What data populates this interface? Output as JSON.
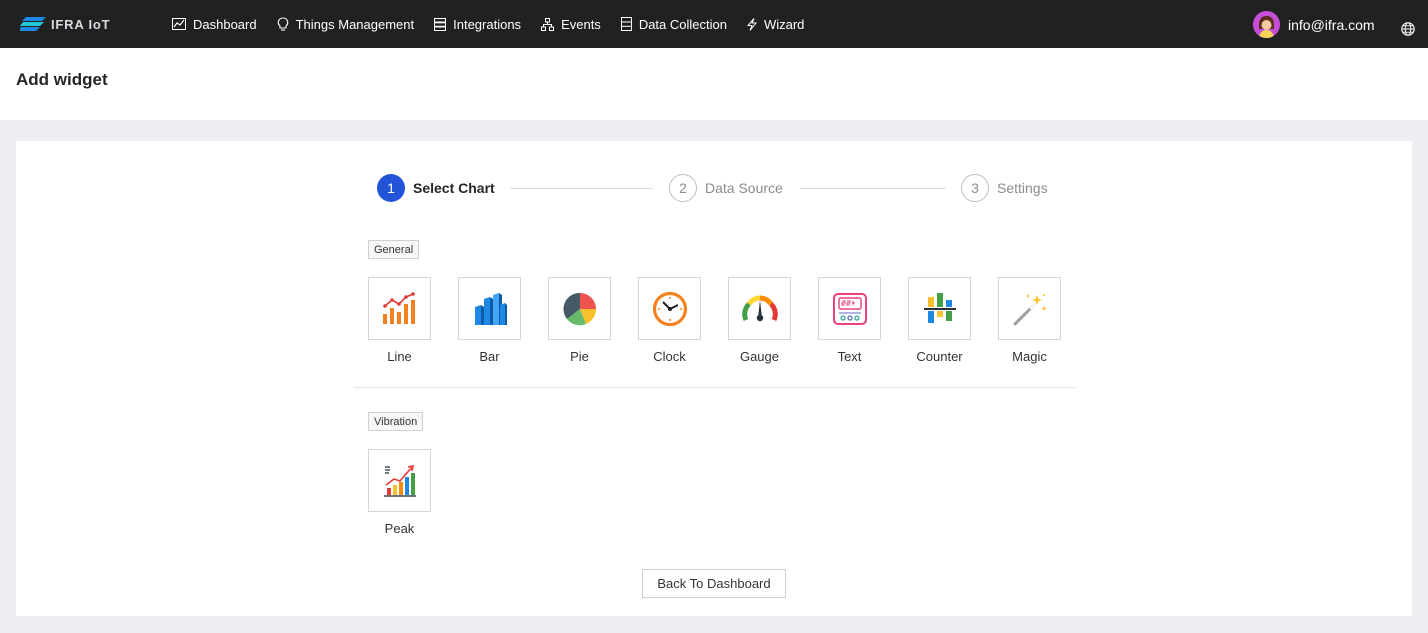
{
  "app": {
    "brand_name": "IFRA IoT"
  },
  "nav": {
    "items": [
      {
        "label": "Dashboard",
        "icon": "line-chart-icon"
      },
      {
        "label": "Things Management",
        "icon": "bulb-icon"
      },
      {
        "label": "Integrations",
        "icon": "server-icon"
      },
      {
        "label": "Events",
        "icon": "cluster-icon"
      },
      {
        "label": "Data Collection",
        "icon": "database-icon"
      },
      {
        "label": "Wizard",
        "icon": "thunderbolt-icon"
      }
    ]
  },
  "user": {
    "email": "info@ifra.com"
  },
  "page": {
    "title": "Add widget"
  },
  "steps": [
    {
      "number": "1",
      "label": "Select Chart",
      "status": "active"
    },
    {
      "number": "2",
      "label": "Data Source",
      "status": "wait"
    },
    {
      "number": "3",
      "label": "Settings",
      "status": "wait"
    }
  ],
  "sections": [
    {
      "tag": "General",
      "widgets": [
        {
          "label": "Line",
          "icon": "line-chart-icon"
        },
        {
          "label": "Bar",
          "icon": "bar-chart-icon"
        },
        {
          "label": "Pie",
          "icon": "pie-chart-icon"
        },
        {
          "label": "Clock",
          "icon": "clock-icon"
        },
        {
          "label": "Gauge",
          "icon": "gauge-icon"
        },
        {
          "label": "Text",
          "icon": "text-display-icon"
        },
        {
          "label": "Counter",
          "icon": "counter-icon"
        },
        {
          "label": "Magic",
          "icon": "magic-wand-icon"
        }
      ]
    },
    {
      "tag": "Vibration",
      "widgets": [
        {
          "label": "Peak",
          "icon": "peak-chart-icon"
        }
      ]
    }
  ],
  "actions": {
    "back_label": "Back To Dashboard"
  },
  "colors": {
    "nav_bg": "#212121",
    "primary": "#2354d8",
    "page_bg": "#eeeff2",
    "avatar_bg": "#c44fd6"
  }
}
